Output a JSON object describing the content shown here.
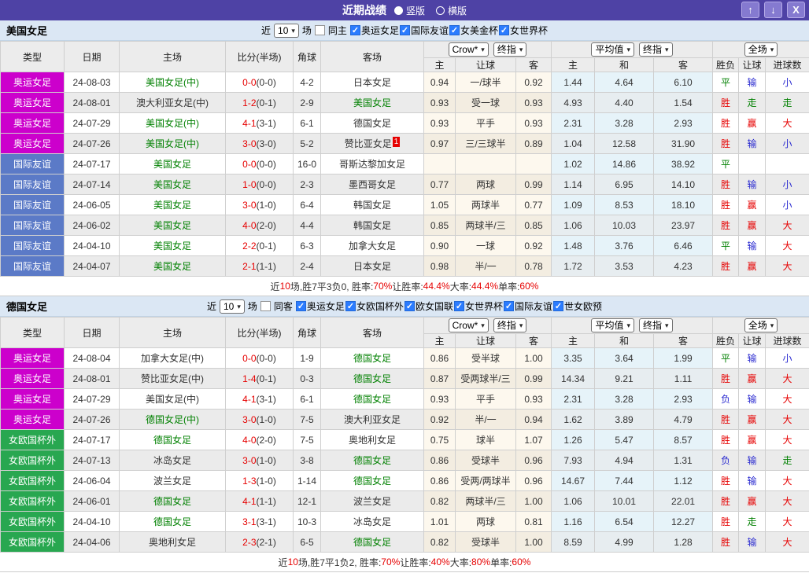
{
  "titlebar": {
    "title": "近期战绩",
    "radios": [
      {
        "label": "竖版",
        "on": true
      },
      {
        "label": "横版",
        "on": false
      }
    ],
    "buttons": {
      "up": "↑",
      "down": "↓",
      "close": "X"
    }
  },
  "ui": {
    "check": "✓",
    "chevron": "▾"
  },
  "colors": {
    "type": {
      "oly": "#cc00cc",
      "fri": "#5b7ac7",
      "euro": "#28a750"
    },
    "accent_purple": "#4e42a5",
    "result_win": "#e60000",
    "result_draw": "#008000",
    "result_lose": "#2a2ad0"
  },
  "table_headers": {
    "type": "类型",
    "date": "日期",
    "home": "主场",
    "score": "比分(半场)",
    "corner": "角球",
    "away": "客场",
    "odds_home": "主",
    "handicap": "让球",
    "odds_away": "客",
    "avg_home": "主",
    "avg_draw": "和",
    "avg_away": "客",
    "result": "胜负",
    "handicap_result": "让球",
    "goals": "进球数"
  },
  "sections": [
    {
      "team": "美国女足",
      "filter": {
        "near": "近",
        "count": "10",
        "matches": "场",
        "same": "同主",
        "leagues": [
          "奥运女足",
          "国际友谊",
          "女美金杯",
          "女世界杯"
        ]
      },
      "controls": {
        "book": "Crow*",
        "final1": "终指",
        "avg": "平均值",
        "final2": "终指",
        "scope": "全场"
      },
      "rows": [
        {
          "t": "奥运女足",
          "tc": "oly",
          "d": "24-08-03",
          "h": "美国女足(中)",
          "hg": true,
          "sf": "0-0",
          "sh": "(0-0)",
          "cr": "4-2",
          "a": "日本女足",
          "ag": false,
          "ab": "",
          "o1": "0.94",
          "hcp": "一/球半",
          "o2": "0.92",
          "v1": "1.44",
          "v2": "4.64",
          "v3": "6.10",
          "r": [
            "平",
            "g"
          ],
          "hr": [
            "输",
            "b"
          ],
          "gr": [
            "小",
            "b"
          ]
        },
        {
          "t": "奥运女足",
          "tc": "oly",
          "d": "24-08-01",
          "h": "澳大利亚女足(中)",
          "hg": false,
          "sf": "1-2",
          "sh": "(0-1)",
          "cr": "2-9",
          "a": "美国女足",
          "ag": true,
          "ab": "",
          "o1": "0.93",
          "hcp": "受一球",
          "o2": "0.93",
          "v1": "4.93",
          "v2": "4.40",
          "v3": "1.54",
          "r": [
            "胜",
            "r"
          ],
          "hr": [
            "走",
            "g"
          ],
          "gr": [
            "走",
            "g"
          ]
        },
        {
          "t": "奥运女足",
          "tc": "oly",
          "d": "24-07-29",
          "h": "美国女足(中)",
          "hg": true,
          "sf": "4-1",
          "sh": "(3-1)",
          "cr": "6-1",
          "a": "德国女足",
          "ag": false,
          "ab": "",
          "o1": "0.93",
          "hcp": "平手",
          "o2": "0.93",
          "v1": "2.31",
          "v2": "3.28",
          "v3": "2.93",
          "r": [
            "胜",
            "r"
          ],
          "hr": [
            "赢",
            "r"
          ],
          "gr": [
            "大",
            "r"
          ]
        },
        {
          "t": "奥运女足",
          "tc": "oly",
          "d": "24-07-26",
          "h": "美国女足(中)",
          "hg": true,
          "sf": "3-0",
          "sh": "(3-0)",
          "cr": "5-2",
          "a": "赞比亚女足",
          "ag": false,
          "ab": "1",
          "o1": "0.97",
          "hcp": "三/三球半",
          "o2": "0.89",
          "v1": "1.04",
          "v2": "12.58",
          "v3": "31.90",
          "r": [
            "胜",
            "r"
          ],
          "hr": [
            "输",
            "b"
          ],
          "gr": [
            "小",
            "b"
          ]
        },
        {
          "t": "国际友谊",
          "tc": "fri",
          "d": "24-07-17",
          "h": "美国女足",
          "hg": true,
          "sf": "0-0",
          "sh": "(0-0)",
          "cr": "16-0",
          "a": "哥斯达黎加女足",
          "ag": false,
          "ab": "",
          "o1": "",
          "hcp": "",
          "o2": "",
          "v1": "1.02",
          "v2": "14.86",
          "v3": "38.92",
          "r": [
            "平",
            "g"
          ],
          "hr": [
            "",
            ""
          ],
          "gr": [
            "",
            ""
          ]
        },
        {
          "t": "国际友谊",
          "tc": "fri",
          "d": "24-07-14",
          "h": "美国女足",
          "hg": true,
          "sf": "1-0",
          "sh": "(0-0)",
          "cr": "2-3",
          "a": "墨西哥女足",
          "ag": false,
          "ab": "",
          "o1": "0.77",
          "hcp": "两球",
          "o2": "0.99",
          "v1": "1.14",
          "v2": "6.95",
          "v3": "14.10",
          "r": [
            "胜",
            "r"
          ],
          "hr": [
            "输",
            "b"
          ],
          "gr": [
            "小",
            "b"
          ]
        },
        {
          "t": "国际友谊",
          "tc": "fri",
          "d": "24-06-05",
          "h": "美国女足",
          "hg": true,
          "sf": "3-0",
          "sh": "(1-0)",
          "cr": "6-4",
          "a": "韩国女足",
          "ag": false,
          "ab": "",
          "o1": "1.05",
          "hcp": "两球半",
          "o2": "0.77",
          "v1": "1.09",
          "v2": "8.53",
          "v3": "18.10",
          "r": [
            "胜",
            "r"
          ],
          "hr": [
            "赢",
            "r"
          ],
          "gr": [
            "小",
            "b"
          ]
        },
        {
          "t": "国际友谊",
          "tc": "fri",
          "d": "24-06-02",
          "h": "美国女足",
          "hg": true,
          "sf": "4-0",
          "sh": "(2-0)",
          "cr": "4-4",
          "a": "韩国女足",
          "ag": false,
          "ab": "",
          "o1": "0.85",
          "hcp": "两球半/三",
          "o2": "0.85",
          "v1": "1.06",
          "v2": "10.03",
          "v3": "23.97",
          "r": [
            "胜",
            "r"
          ],
          "hr": [
            "赢",
            "r"
          ],
          "gr": [
            "大",
            "r"
          ]
        },
        {
          "t": "国际友谊",
          "tc": "fri",
          "d": "24-04-10",
          "h": "美国女足",
          "hg": true,
          "sf": "2-2",
          "sh": "(0-1)",
          "cr": "6-3",
          "a": "加拿大女足",
          "ag": false,
          "ab": "",
          "o1": "0.90",
          "hcp": "一球",
          "o2": "0.92",
          "v1": "1.48",
          "v2": "3.76",
          "v3": "6.46",
          "r": [
            "平",
            "g"
          ],
          "hr": [
            "输",
            "b"
          ],
          "gr": [
            "大",
            "r"
          ]
        },
        {
          "t": "国际友谊",
          "tc": "fri",
          "d": "24-04-07",
          "h": "美国女足",
          "hg": true,
          "sf": "2-1",
          "sh": "(1-1)",
          "cr": "2-4",
          "a": "日本女足",
          "ag": false,
          "ab": "",
          "o1": "0.98",
          "hcp": "半/一",
          "o2": "0.78",
          "v1": "1.72",
          "v2": "3.53",
          "v3": "4.23",
          "r": [
            "胜",
            "r"
          ],
          "hr": [
            "赢",
            "r"
          ],
          "gr": [
            "大",
            "r"
          ]
        }
      ],
      "summary": [
        [
          "近",
          0
        ],
        [
          "10",
          1
        ],
        [
          "场,胜7平3负0, 胜率:",
          0
        ],
        [
          "70%",
          1
        ],
        [
          " 让胜率:",
          0
        ],
        [
          "44.4%",
          1
        ],
        [
          " 大率:",
          0
        ],
        [
          "44.4%",
          1
        ],
        [
          " 单率:",
          0
        ],
        [
          "60%",
          1
        ]
      ]
    },
    {
      "team": "德国女足",
      "filter": {
        "near": "近",
        "count": "10",
        "matches": "场",
        "same": "同客",
        "leagues": [
          "奥运女足",
          "女欧国杯外",
          "欧女国联",
          "女世界杯",
          "国际友谊",
          "世女欧预"
        ]
      },
      "controls": {
        "book": "Crow*",
        "final1": "终指",
        "avg": "平均值",
        "final2": "终指",
        "scope": "全场"
      },
      "rows": [
        {
          "t": "奥运女足",
          "tc": "oly",
          "d": "24-08-04",
          "h": "加拿大女足(中)",
          "hg": false,
          "sf": "0-0",
          "sh": "(0-0)",
          "cr": "1-9",
          "a": "德国女足",
          "ag": true,
          "ab": "",
          "o1": "0.86",
          "hcp": "受半球",
          "o2": "1.00",
          "v1": "3.35",
          "v2": "3.64",
          "v3": "1.99",
          "r": [
            "平",
            "g"
          ],
          "hr": [
            "输",
            "b"
          ],
          "gr": [
            "小",
            "b"
          ]
        },
        {
          "t": "奥运女足",
          "tc": "oly",
          "d": "24-08-01",
          "h": "赞比亚女足(中)",
          "hg": false,
          "sf": "1-4",
          "sh": "(0-1)",
          "cr": "0-3",
          "a": "德国女足",
          "ag": true,
          "ab": "",
          "o1": "0.87",
          "hcp": "受两球半/三",
          "o2": "0.99",
          "v1": "14.34",
          "v2": "9.21",
          "v3": "1.11",
          "r": [
            "胜",
            "r"
          ],
          "hr": [
            "赢",
            "r"
          ],
          "gr": [
            "大",
            "r"
          ]
        },
        {
          "t": "奥运女足",
          "tc": "oly",
          "d": "24-07-29",
          "h": "美国女足(中)",
          "hg": false,
          "sf": "4-1",
          "sh": "(3-1)",
          "cr": "6-1",
          "a": "德国女足",
          "ag": true,
          "ab": "",
          "o1": "0.93",
          "hcp": "平手",
          "o2": "0.93",
          "v1": "2.31",
          "v2": "3.28",
          "v3": "2.93",
          "r": [
            "负",
            "b"
          ],
          "hr": [
            "输",
            "b"
          ],
          "gr": [
            "大",
            "r"
          ]
        },
        {
          "t": "奥运女足",
          "tc": "oly",
          "d": "24-07-26",
          "h": "德国女足(中)",
          "hg": true,
          "sf": "3-0",
          "sh": "(1-0)",
          "cr": "7-5",
          "a": "澳大利亚女足",
          "ag": false,
          "ab": "",
          "o1": "0.92",
          "hcp": "半/一",
          "o2": "0.94",
          "v1": "1.62",
          "v2": "3.89",
          "v3": "4.79",
          "r": [
            "胜",
            "r"
          ],
          "hr": [
            "赢",
            "r"
          ],
          "gr": [
            "大",
            "r"
          ]
        },
        {
          "t": "女欧国杯外",
          "tc": "euro",
          "d": "24-07-17",
          "h": "德国女足",
          "hg": true,
          "sf": "4-0",
          "sh": "(2-0)",
          "cr": "7-5",
          "a": "奥地利女足",
          "ag": false,
          "ab": "",
          "o1": "0.75",
          "hcp": "球半",
          "o2": "1.07",
          "v1": "1.26",
          "v2": "5.47",
          "v3": "8.57",
          "r": [
            "胜",
            "r"
          ],
          "hr": [
            "赢",
            "r"
          ],
          "gr": [
            "大",
            "r"
          ]
        },
        {
          "t": "女欧国杯外",
          "tc": "euro",
          "d": "24-07-13",
          "h": "冰岛女足",
          "hg": false,
          "sf": "3-0",
          "sh": "(1-0)",
          "cr": "3-8",
          "a": "德国女足",
          "ag": true,
          "ab": "",
          "o1": "0.86",
          "hcp": "受球半",
          "o2": "0.96",
          "v1": "7.93",
          "v2": "4.94",
          "v3": "1.31",
          "r": [
            "负",
            "b"
          ],
          "hr": [
            "输",
            "b"
          ],
          "gr": [
            "走",
            "g"
          ]
        },
        {
          "t": "女欧国杯外",
          "tc": "euro",
          "d": "24-06-04",
          "h": "波兰女足",
          "hg": false,
          "sf": "1-3",
          "sh": "(1-0)",
          "cr": "1-14",
          "a": "德国女足",
          "ag": true,
          "ab": "",
          "o1": "0.86",
          "hcp": "受两/两球半",
          "o2": "0.96",
          "v1": "14.67",
          "v2": "7.44",
          "v3": "1.12",
          "r": [
            "胜",
            "r"
          ],
          "hr": [
            "输",
            "b"
          ],
          "gr": [
            "大",
            "r"
          ]
        },
        {
          "t": "女欧国杯外",
          "tc": "euro",
          "d": "24-06-01",
          "h": "德国女足",
          "hg": true,
          "sf": "4-1",
          "sh": "(1-1)",
          "cr": "12-1",
          "a": "波兰女足",
          "ag": false,
          "ab": "",
          "o1": "0.82",
          "hcp": "两球半/三",
          "o2": "1.00",
          "v1": "1.06",
          "v2": "10.01",
          "v3": "22.01",
          "r": [
            "胜",
            "r"
          ],
          "hr": [
            "赢",
            "r"
          ],
          "gr": [
            "大",
            "r"
          ]
        },
        {
          "t": "女欧国杯外",
          "tc": "euro",
          "d": "24-04-10",
          "h": "德国女足",
          "hg": true,
          "sf": "3-1",
          "sh": "(3-1)",
          "cr": "10-3",
          "a": "冰岛女足",
          "ag": false,
          "ab": "",
          "o1": "1.01",
          "hcp": "两球",
          "o2": "0.81",
          "v1": "1.16",
          "v2": "6.54",
          "v3": "12.27",
          "r": [
            "胜",
            "r"
          ],
          "hr": [
            "走",
            "g"
          ],
          "gr": [
            "大",
            "r"
          ]
        },
        {
          "t": "女欧国杯外",
          "tc": "euro",
          "d": "24-04-06",
          "h": "奥地利女足",
          "hg": false,
          "sf": "2-3",
          "sh": "(2-1)",
          "cr": "6-5",
          "a": "德国女足",
          "ag": true,
          "ab": "",
          "o1": "0.82",
          "hcp": "受球半",
          "o2": "1.00",
          "v1": "8.59",
          "v2": "4.99",
          "v3": "1.28",
          "r": [
            "胜",
            "r"
          ],
          "hr": [
            "输",
            "b"
          ],
          "gr": [
            "大",
            "r"
          ]
        }
      ],
      "summary": [
        [
          "近",
          0
        ],
        [
          "10",
          1
        ],
        [
          "场,胜7平1负2, 胜率:",
          0
        ],
        [
          "70%",
          1
        ],
        [
          " 让胜率:",
          0
        ],
        [
          "40%",
          1
        ],
        [
          " 大率:",
          0
        ],
        [
          "80%",
          1
        ],
        [
          " 单率:",
          0
        ],
        [
          "60%",
          1
        ]
      ]
    }
  ]
}
